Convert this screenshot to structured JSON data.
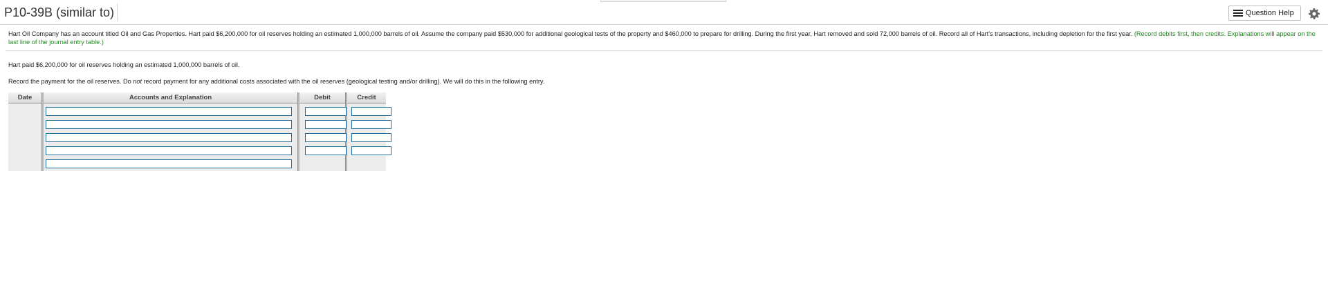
{
  "header": {
    "title": "P10-39B (similar to)",
    "question_help_label": "Question Help"
  },
  "icons": {
    "question_help": "list-icon",
    "settings": "gear-icon"
  },
  "question": {
    "text": "Hart Oil Company has an account titled Oil and Gas Properties. Hart paid $6,200,000 for oil reserves holding an estimated 1,000,000 barrels of oil. Assume the company paid $530,000 for additional geological tests of the property and $460,000 to prepare for drilling. During the first year, Hart removed and sold 72,000 barrels of oil. Record all of Hart's transactions, including depletion for the first year.",
    "note": "(Record debits first, then credits. Explanations will appear on the last line of the journal entry table.)"
  },
  "step": {
    "fact": "Hart paid $6,200,000 for oil reserves holding an estimated 1,000,000 barrels of oil.",
    "instruction_pre": "Record the payment for the oil reserves. Do ",
    "instruction_em": "not",
    "instruction_post": " record payment for any additional costs associated with the oil reserves (geological testing and/or drilling). We will do this in the following entry."
  },
  "journal": {
    "headers": {
      "date": "Date",
      "accounts": "Accounts and Explanation",
      "debit": "Debit",
      "credit": "Credit"
    },
    "rows": [
      {
        "account": "",
        "debit": "",
        "credit": ""
      },
      {
        "account": "",
        "debit": "",
        "credit": ""
      },
      {
        "account": "",
        "debit": "",
        "credit": ""
      },
      {
        "account": "",
        "debit": "",
        "credit": ""
      }
    ],
    "explanation": ""
  },
  "colors": {
    "note_green": "#1f8a1f",
    "input_border": "#1f6f9a",
    "table_bg": "#ececec"
  }
}
